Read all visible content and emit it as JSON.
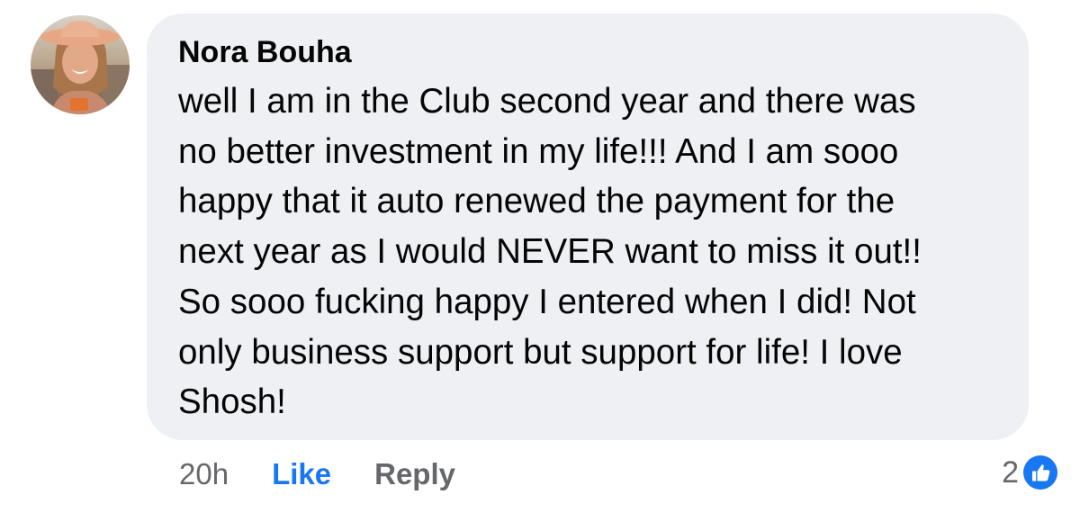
{
  "comment": {
    "author": "Nora Bouha",
    "text": "well I am in the Club second year and there was\nno better investment in my life!!! And I am sooo\nhappy that it auto renewed the payment for the\nnext year as I would NEVER want to miss it out!!\nSo sooo fucking happy I entered when I did! Not\nonly business support but support for life! I love\nShosh!",
    "timestamp": "20h",
    "like_label": "Like",
    "reply_label": "Reply",
    "reaction_count": "2",
    "reaction_icon": "thumbs-up-icon"
  },
  "colors": {
    "bubble_bg": "#eef0f3",
    "like_blue": "#1877f2",
    "meta_gray": "#65676b",
    "text": "#050505"
  }
}
